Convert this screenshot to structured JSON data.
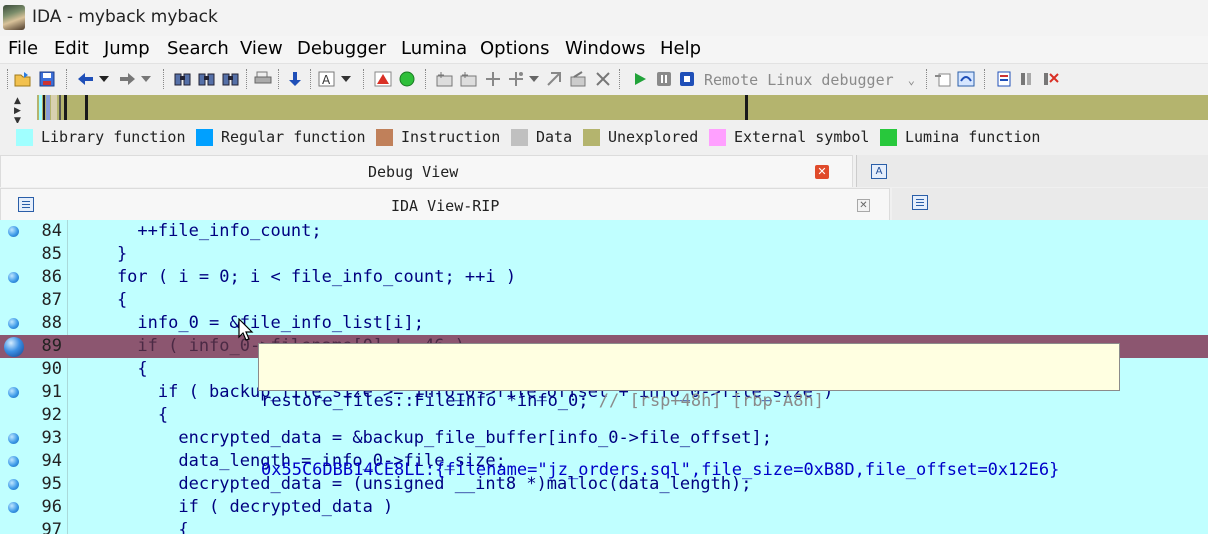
{
  "window": {
    "title": "IDA - myback myback"
  },
  "menu": [
    "File",
    "Edit",
    "Jump",
    "Search",
    "View",
    "Debugger",
    "Lumina",
    "Options",
    "Windows",
    "Help"
  ],
  "toolbar": {
    "debugger_select": "Remote Linux debugger"
  },
  "legend": [
    {
      "label": "Library function",
      "color": "#a0ffff"
    },
    {
      "label": "Regular function",
      "color": "#00a0ff"
    },
    {
      "label": "Instruction",
      "color": "#c0805a"
    },
    {
      "label": "Data",
      "color": "#c0c0c0"
    },
    {
      "label": "Unexplored",
      "color": "#b4b46e"
    },
    {
      "label": "External symbol",
      "color": "#ffa0ff"
    },
    {
      "label": "Lumina function",
      "color": "#28c83c"
    }
  ],
  "tabs": {
    "debug_view": "Debug View",
    "ida_view": "IDA View-RIP",
    "side_icon_letter": "A"
  },
  "code": {
    "lines": [
      {
        "no": "84",
        "text": "      ++file_info_count;",
        "bp": true
      },
      {
        "no": "85",
        "text": "    }",
        "bp": false
      },
      {
        "no": "86",
        "text": "    for ( i = 0; i < file_info_count; ++i )",
        "bp": true
      },
      {
        "no": "87",
        "text": "    {",
        "bp": false
      },
      {
        "no": "88",
        "text": "      info_0 = &file_info_list[i];",
        "bp": true
      },
      {
        "no": "89",
        "text": "      if ( info_0->filename[0] != 46 )",
        "bp": true,
        "current": true
      },
      {
        "no": "90",
        "text": "      {",
        "bp": false
      },
      {
        "no": "91",
        "text": "        if ( backup_file_size >= info_0->file_offset + info_0->file_size )",
        "bp": true
      },
      {
        "no": "92",
        "text": "        {",
        "bp": false
      },
      {
        "no": "93",
        "text": "          encrypted_data = &backup_file_buffer[info_0->file_offset];",
        "bp": true
      },
      {
        "no": "94",
        "text": "          data_length = info_0->file_size;",
        "bp": true
      },
      {
        "no": "95",
        "text": "          decrypted_data = (unsigned __int8 *)malloc(data_length);",
        "bp": true
      },
      {
        "no": "96",
        "text": "          if ( decrypted_data )",
        "bp": true
      },
      {
        "no": "97",
        "text": "          {",
        "bp": false
      }
    ]
  },
  "tooltip": {
    "decl": "restore_files::FileInfo *info_0; ",
    "comment": "// [rsp+48h] [rbp-A8h]",
    "value": "0x55C6DBB14CE8LL:{filename=\"jz_orders.sql\",file_size=0xB8D,file_offset=0x12E6}"
  }
}
